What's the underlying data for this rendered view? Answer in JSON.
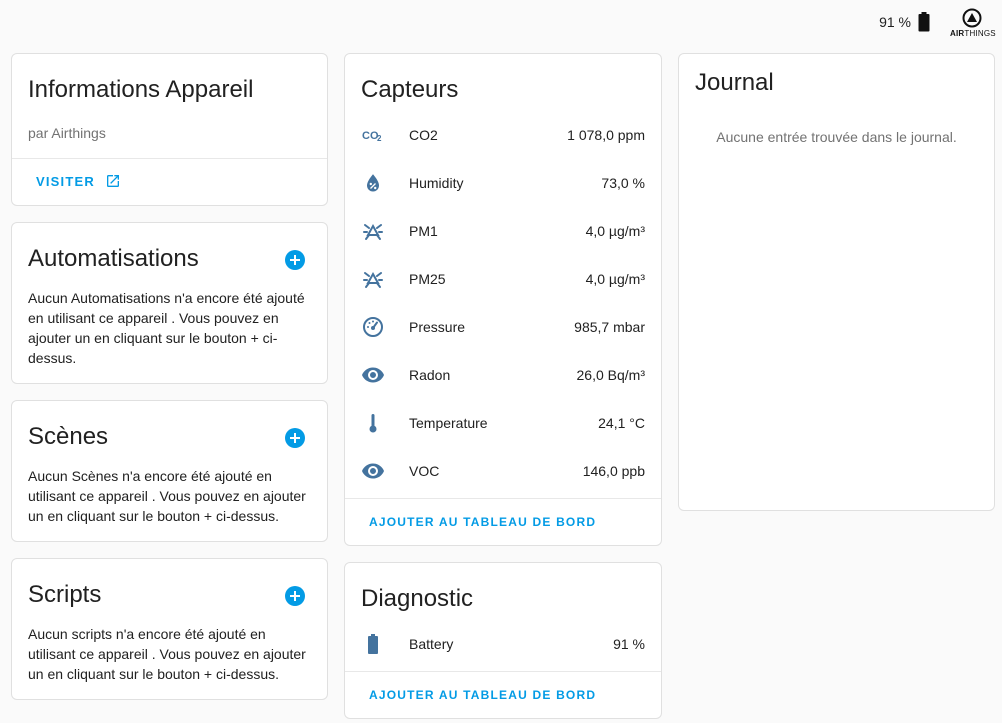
{
  "topbar": {
    "battery_text": "91 %",
    "logo_text_bold": "AIR",
    "logo_text_rest": "THINGS"
  },
  "device_info": {
    "title": "Informations Appareil",
    "manufacturer": "par Airthings",
    "visit_label": "VISITER"
  },
  "automations": {
    "title": "Automatisations",
    "text": "Aucun Automatisations n'a encore été ajouté en utilisant ce appareil . Vous pouvez en ajouter un en cliquant sur le bouton + ci-dessus."
  },
  "scenes": {
    "title": "Scènes",
    "text": "Aucun Scènes n'a encore été ajouté en utilisant ce appareil . Vous pouvez en ajouter un en cliquant sur le bouton + ci-dessus."
  },
  "scripts": {
    "title": "Scripts",
    "text": "Aucun scripts n'a encore été ajouté en utilisant ce appareil . Vous pouvez en ajouter un en cliquant sur le bouton + ci-dessus."
  },
  "sensors": {
    "title": "Capteurs",
    "add_label": "AJOUTER AU TABLEAU DE BORD",
    "items": [
      {
        "icon": "co2-icon",
        "name": "CO2",
        "value": "1 078,0 ppm"
      },
      {
        "icon": "water-percent-icon",
        "name": "Humidity",
        "value": "73,0 %"
      },
      {
        "icon": "particles-icon",
        "name": "PM1",
        "value": "4,0 µg/m³"
      },
      {
        "icon": "particles-icon",
        "name": "PM25",
        "value": "4,0 µg/m³"
      },
      {
        "icon": "gauge-icon",
        "name": "Pressure",
        "value": "985,7 mbar"
      },
      {
        "icon": "eye-icon",
        "name": "Radon",
        "value": "26,0 Bq/m³"
      },
      {
        "icon": "thermometer-icon",
        "name": "Temperature",
        "value": "24,1 °C"
      },
      {
        "icon": "eye-icon",
        "name": "VOC",
        "value": "146,0 ppb"
      }
    ]
  },
  "diagnostic": {
    "title": "Diagnostic",
    "add_label": "AJOUTER AU TABLEAU DE BORD",
    "items": [
      {
        "icon": "battery-icon",
        "name": "Battery",
        "value": "91 %"
      }
    ]
  },
  "journal": {
    "title": "Journal",
    "empty_text": "Aucune entrée trouvée dans le journal."
  },
  "colors": {
    "accent": "#039be5",
    "icon": "#44739e",
    "text": "#212121",
    "muted": "#727272",
    "background": "#fafafa"
  }
}
